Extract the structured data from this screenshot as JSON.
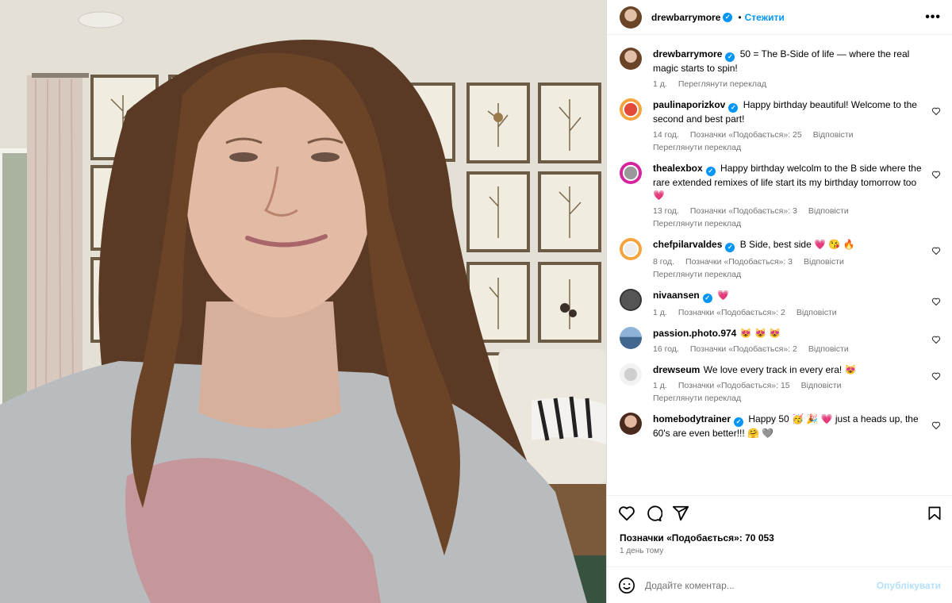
{
  "header": {
    "username": "drewbarrymore",
    "dot": "•",
    "follow_label": "Стежити",
    "more_label": "•••"
  },
  "caption": {
    "username": "drewbarrymore",
    "text": "50 = The B-Side of life — where the real magic starts to spin!",
    "time": "1 д.",
    "translate": "Переглянути переклад"
  },
  "comments": [
    {
      "username": "paulinaporizkov",
      "verified": true,
      "text": "Happy birthday beautiful! Welcome to the second and best part!",
      "time": "14 год.",
      "likes": "Позначки «Подобається»: 25",
      "reply": "Відповісти",
      "translate": "Переглянути переклад"
    },
    {
      "username": "thealexbox",
      "verified": true,
      "text": "Happy birthday welcolm to the B side where the rare extended remixes of life start its my birthday tomorrow too 💗",
      "time": "13 год.",
      "likes": "Позначки «Подобається»: 3",
      "reply": "Відповісти",
      "translate": "Переглянути переклад"
    },
    {
      "username": "chefpilarvaldes",
      "verified": true,
      "text": "B Side, best side 💗 😘 🔥",
      "time": "8 год.",
      "likes": "Позначки «Подобається»: 3",
      "reply": "Відповісти",
      "translate": "Переглянути переклад"
    },
    {
      "username": "nivaansen",
      "verified": true,
      "text": "💗",
      "time": "1 д.",
      "likes": "Позначки «Подобається»: 2",
      "reply": "Відповісти",
      "translate": ""
    },
    {
      "username": "passion.photo.974",
      "verified": false,
      "text": "😻 😻 😻",
      "time": "16 год.",
      "likes": "Позначки «Подобається»: 2",
      "reply": "Відповісти",
      "translate": ""
    },
    {
      "username": "drewseum",
      "verified": false,
      "text": "We love every track in every era! 😻",
      "time": "1 д.",
      "likes": "Позначки «Подобається»: 15",
      "reply": "Відповісти",
      "translate": "Переглянути переклад"
    },
    {
      "username": "homebodytrainer",
      "verified": true,
      "text": "Happy 50 🥳 🎉 💗 just a heads up, the 60's are even better!!! 🤗 🩶",
      "time": "",
      "likes": "",
      "reply": "",
      "translate": ""
    }
  ],
  "footer": {
    "likes": "Позначки «Подобається»: 70 053",
    "ago": "1 день тому",
    "comment_placeholder": "Додайте коментар...",
    "post_label": "Опублікувати"
  },
  "colors": {
    "accent": "#0095f6",
    "verified": "#0095f6",
    "muted": "#737373",
    "post_disabled": "#b2dffc"
  },
  "icons": [
    "more-icon",
    "heart-icon",
    "comment-icon",
    "share-icon",
    "bookmark-icon",
    "emoji-icon",
    "verified-icon"
  ]
}
